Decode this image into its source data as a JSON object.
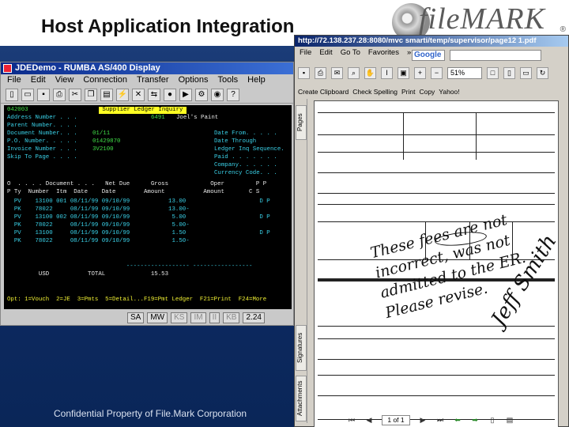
{
  "slide": {
    "title": "Host Application Integration",
    "logo_text": "fileMARK",
    "logo_reg": "®",
    "footer": "Confidential Property of File.Mark Corporation"
  },
  "rumba": {
    "title": "JDEDemo - RUMBA AS/400 Display",
    "menu": [
      "File",
      "Edit",
      "View",
      "Connection",
      "Transfer",
      "Options",
      "Tools",
      "Help"
    ],
    "terminal": {
      "screen_id": "042003",
      "heading": " Supplier Ledger Inquiry ",
      "address_label": "Address Number . . .",
      "address_value": "6491",
      "address_name": "Joel's Paint",
      "parent_label": "Parent Number. . . .",
      "document_label": "Document Number. . .",
      "document_value": "01/11",
      "po_label": "P.O. Number. . . . .",
      "po_value": "01429870",
      "invoice_label": "Invoice Number . . .",
      "invoice_value": "3V2100",
      "skip_label": "Skip To Page . . . .",
      "date_from": "Date From. . . . .",
      "date_through": "Date Through",
      "ledger_seq": "Ledger Inq Sequence.",
      "paid": "Paid . . . . . . .",
      "company": "Company. . . . . .",
      "currency": "Currency Code. . .",
      "col_header1": "O  . . . . Document . . .   Net Due      Gross            Oper         P P",
      "col_header2": "P Ty  Number  Itm  Date    Date        Amount           Amount       C S",
      "rows": [
        "  PV    13100 001 08/11/99 09/10/99           13.00                     D P",
        "  PK    78022     08/11/99 09/10/99           13.00-",
        "  PV    13100 002 08/11/99 09/10/99            5.00                     D P",
        "  PK    78022     08/11/99 09/10/99            5.00-",
        "  PV    13100     08/11/99 09/10/99            1.50                     D P",
        "  PK    78022     08/11/99 09/10/99            1.50-"
      ],
      "total_sep": "                                  ------------------ -----------------",
      "total_row": "         USD           TOTAL             15.53",
      "function_keys": "Opt: 1=Vouch  2=JE  3=Pmts  5=Detail...F19=Pmt Ledger  F21=Print  F24=More"
    },
    "status": [
      "SA",
      "MW",
      "KS",
      "IM",
      "II",
      "KB",
      "2.24"
    ]
  },
  "browser": {
    "title": "http://72.138.237.28:8080/mvc smarti/temp/supervisor/page12 1.pdf",
    "menu": [
      "File",
      "Edit",
      "Go To",
      "Favorites",
      "»"
    ],
    "google_label": "Google",
    "zoom": "51%",
    "toolbar2": [
      "Create Clipboard",
      "Check Spelling",
      "Print",
      "Copy",
      "Yahoo!"
    ],
    "side_tabs": [
      "Pages",
      "Signatures",
      "Attachments"
    ],
    "handwritten_note": "These fees are not\nincorrect, was not\nadmitted to the ER.\nPlease revise.",
    "signature": "Jeff Smith",
    "page_indicator": "1 of 1"
  },
  "colors": {
    "terminal_bg": "#000000",
    "terminal_text": "#3ad1e8",
    "terminal_highlight": "#ffff22",
    "slide_blue": "#1b3c78"
  }
}
